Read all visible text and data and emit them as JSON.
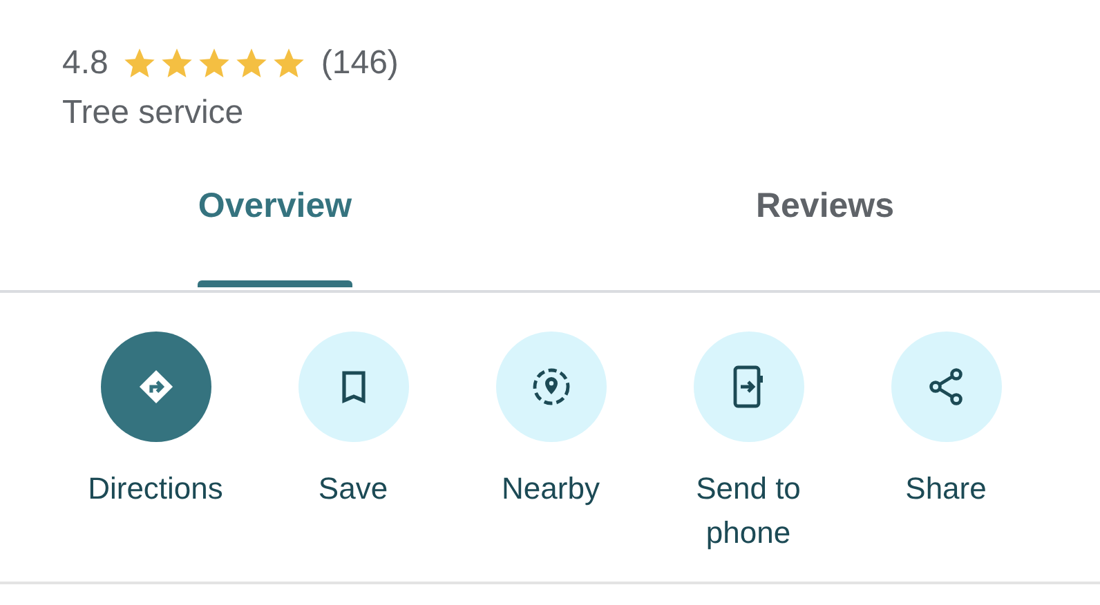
{
  "rating": {
    "value": "4.8",
    "stars": 5,
    "count": "(146)"
  },
  "category": "Tree service",
  "tabs": [
    {
      "label": "Overview",
      "selected": true
    },
    {
      "label": "Reviews",
      "selected": false
    }
  ],
  "actions": [
    {
      "label": "Directions",
      "kind": "primary"
    },
    {
      "label": "Save",
      "kind": "tonal"
    },
    {
      "label": "Nearby",
      "kind": "tonal"
    },
    {
      "label": "Send to phone",
      "kind": "tonal"
    },
    {
      "label": "Share",
      "kind": "tonal"
    }
  ]
}
